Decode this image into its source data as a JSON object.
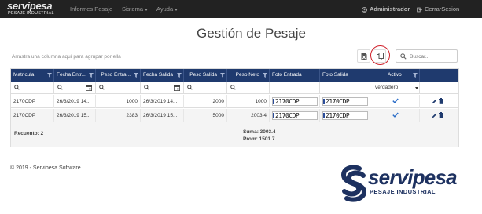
{
  "navbar": {
    "brand_main": "servipesa",
    "brand_sub": "PESAJE INDUSTRIAL",
    "items": [
      "Informes Pesaje",
      "Sistema",
      "Ayuda"
    ],
    "user": "Administrador",
    "logout": "CerrarSesion"
  },
  "page": {
    "title": "Gestión de Pesaje",
    "group_panel": "Arrastra una columna aquí para agrupar por ella",
    "search_placeholder": "Buscar..."
  },
  "grid": {
    "columns": [
      "Matricula",
      "Fecha Entr...",
      "Peso Entra...",
      "Fecha Salida",
      "Peso Salida",
      "Peso Neto",
      "Foto Entrada",
      "Foto Salida",
      "Activo",
      ""
    ],
    "filter_activo": "verdadero",
    "rows": [
      {
        "matricula": "2170CDP",
        "fecha_entrada": "26/3/2019 14...",
        "peso_entrada": "1000",
        "fecha_salida": "26/3/2019 14...",
        "peso_salida": "2000",
        "peso_neto": "1000",
        "foto_entrada": "2170CDP",
        "foto_salida": "2170CDP"
      },
      {
        "matricula": "2170CDP",
        "fecha_entrada": "26/3/2019 15...",
        "peso_entrada": "2383",
        "fecha_salida": "26/3/2019 15...",
        "peso_salida": "5000",
        "peso_neto": "2003.4",
        "foto_entrada": "2170CDP",
        "foto_salida": "2170CDP"
      }
    ],
    "summary": {
      "count": "Recuento: 2",
      "sum": "Suma: 3003.4",
      "avg": "Prom: 1501.7"
    }
  },
  "footer": {
    "copyright": "© 2019 - Servipesa Software",
    "logo_word": "servipesa",
    "logo_sub": "PESAJE INDUSTRIAL"
  },
  "colors": {
    "navbar": "#222222",
    "grid_header": "#1f3a6e",
    "highlight": "#d0202a",
    "brand": "#1d3160"
  }
}
